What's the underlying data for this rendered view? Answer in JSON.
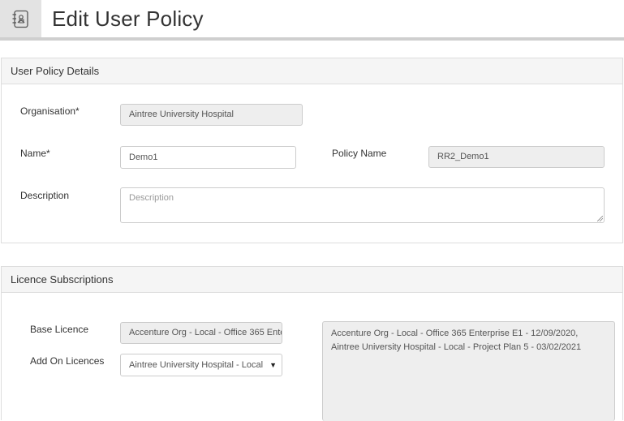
{
  "page": {
    "title": "Edit User Policy",
    "header_icon": "policy-notebook-icon"
  },
  "details_panel": {
    "heading": "User Policy Details",
    "organisation": {
      "label": "Organisation*",
      "value": "Aintree University Hospital"
    },
    "name": {
      "label": "Name*",
      "value": "Demo1"
    },
    "policy_name": {
      "label": "Policy Name",
      "value": "RR2_Demo1"
    },
    "description": {
      "label": "Description",
      "placeholder": "Description"
    }
  },
  "licence_panel": {
    "heading": "Licence Subscriptions",
    "base_licence": {
      "label": "Base Licence",
      "value": "Accenture Org - Local - Office 365 Enterprise E1"
    },
    "add_on_licences": {
      "label": "Add On Licences",
      "selected": "Aintree University Hospital - Local"
    },
    "summary_lines": [
      "Accenture Org - Local - Office 365 Enterprise E1 - 12/09/2020,",
      "Aintree University Hospital - Local - Project Plan 5 - 03/02/2021"
    ]
  },
  "colors": {
    "panel_heading_bg": "#f5f5f5",
    "readonly_bg": "#eeeeee",
    "border": "#cccccc"
  }
}
